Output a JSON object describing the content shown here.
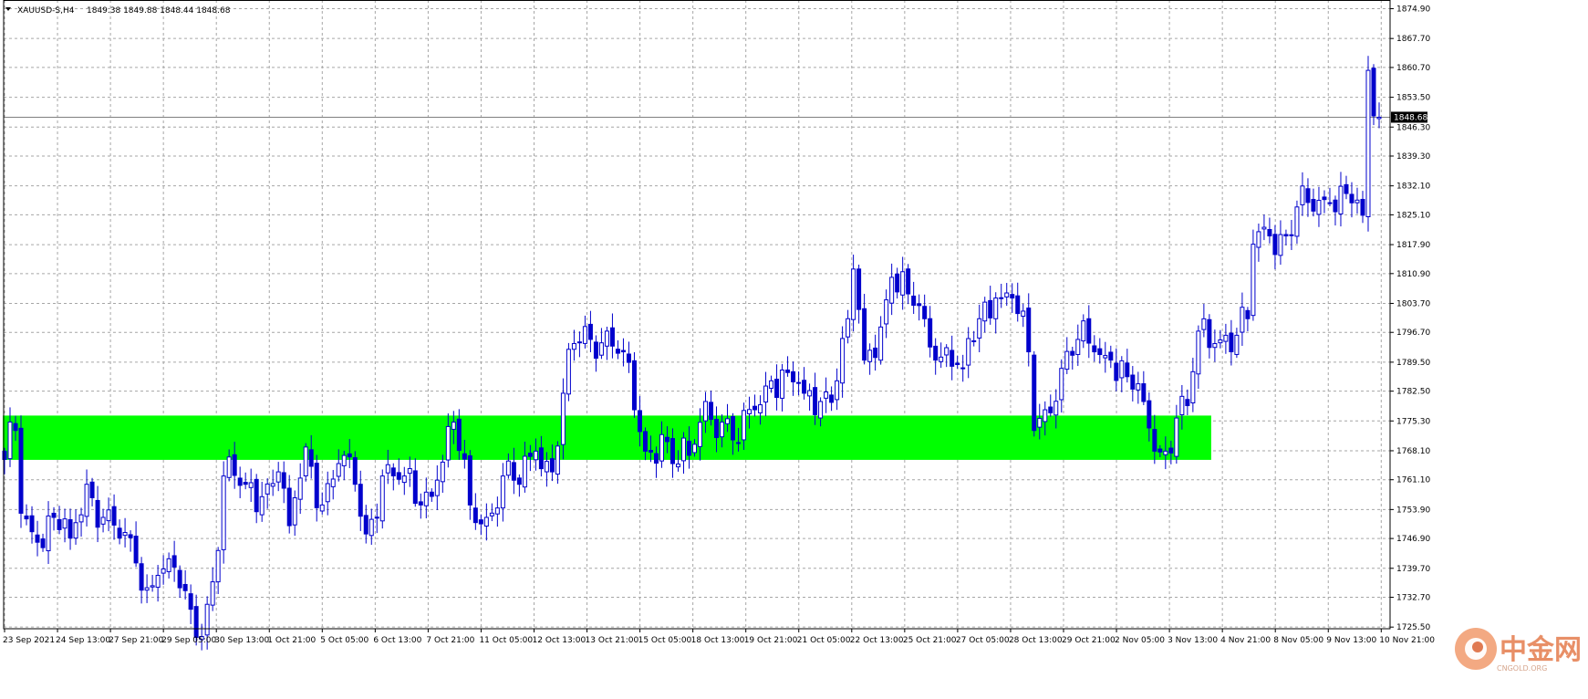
{
  "chart_header": {
    "symbol": "XAUUSD-S,H4",
    "ohlc": "1849.38 1849.88 1848.44 1848.68"
  },
  "current_price_label": "1848.68",
  "watermark": {
    "text_cn": "中金网",
    "text_en": "CNGOLD.ORG"
  },
  "colors": {
    "background": "#ffffff",
    "candle": "#0000cc",
    "grid": "#a6a6a6",
    "zone": "#00ff00",
    "price_line": "#7f7f7f"
  },
  "chart_data": {
    "type": "candlestick",
    "title": "",
    "xlabel": "",
    "ylabel": "",
    "ylim": [
      1725.1,
      1877.0
    ],
    "grid": true,
    "legend": "none",
    "y_ticks": [
      "1874.90",
      "1867.70",
      "1860.70",
      "1853.50",
      "1846.30",
      "1839.30",
      "1832.10",
      "1825.10",
      "1817.90",
      "1810.90",
      "1803.70",
      "1796.70",
      "1789.50",
      "1782.50",
      "1775.30",
      "1768.10",
      "1761.10",
      "1753.90",
      "1746.90",
      "1739.70",
      "1732.70",
      "1725.50"
    ],
    "x_ticks": [
      "23 Sep 2021",
      "24 Sep 13:00",
      "27 Sep 21:00",
      "29 Sep 05:00",
      "30 Sep 13:00",
      "1 Oct 21:00",
      "5 Oct 05:00",
      "6 Oct 13:00",
      "7 Oct 21:00",
      "11 Oct 05:00",
      "12 Oct 13:00",
      "13 Oct 21:00",
      "15 Oct 05:00",
      "18 Oct 13:00",
      "19 Oct 21:00",
      "21 Oct 05:00",
      "22 Oct 13:00",
      "25 Oct 21:00",
      "27 Oct 05:00",
      "28 Oct 13:00",
      "29 Oct 21:00",
      "2 Nov 05:00",
      "3 Nov 13:00",
      "4 Nov 21:00",
      "8 Nov 05:00",
      "9 Nov 13:00",
      "10 Nov 21:00"
    ],
    "candle_count": 252,
    "support_zone": {
      "upper": 1776.6,
      "lower": 1765.9,
      "start_candle": 0,
      "end_candle": 220
    },
    "current_price": 1848.68,
    "close_anchors": [
      [
        0,
        1766
      ],
      [
        2,
        1773
      ],
      [
        3,
        1753
      ],
      [
        6,
        1746
      ],
      [
        9,
        1752
      ],
      [
        12,
        1747
      ],
      [
        15,
        1760
      ],
      [
        18,
        1752
      ],
      [
        21,
        1747
      ],
      [
        24,
        1741
      ],
      [
        26,
        1735
      ],
      [
        28,
        1738
      ],
      [
        30,
        1742
      ],
      [
        32,
        1735
      ],
      [
        35,
        1723
      ],
      [
        37,
        1731
      ],
      [
        39,
        1744
      ],
      [
        40,
        1762
      ],
      [
        44,
        1760
      ],
      [
        47,
        1757
      ],
      [
        50,
        1763
      ],
      [
        52,
        1750
      ],
      [
        55,
        1769
      ],
      [
        58,
        1755
      ],
      [
        61,
        1765
      ],
      [
        64,
        1760
      ],
      [
        66,
        1748
      ],
      [
        69,
        1762
      ],
      [
        73,
        1762
      ],
      [
        76,
        1755
      ],
      [
        79,
        1761
      ],
      [
        82,
        1775
      ],
      [
        85,
        1755
      ],
      [
        88,
        1752
      ],
      [
        91,
        1762
      ],
      [
        94,
        1760
      ],
      [
        97,
        1768
      ],
      [
        100,
        1763
      ],
      [
        102,
        1782
      ],
      [
        104,
        1794
      ],
      [
        107,
        1795
      ],
      [
        110,
        1797
      ],
      [
        113,
        1792
      ],
      [
        115,
        1778
      ],
      [
        117,
        1768
      ],
      [
        120,
        1772
      ],
      [
        122,
        1765
      ],
      [
        125,
        1767
      ],
      [
        128,
        1780
      ],
      [
        131,
        1775
      ],
      [
        134,
        1770
      ],
      [
        137,
        1778
      ],
      [
        140,
        1785
      ],
      [
        143,
        1787
      ],
      [
        146,
        1782
      ],
      [
        149,
        1780
      ],
      [
        152,
        1785
      ],
      [
        154,
        1800
      ],
      [
        155,
        1812
      ],
      [
        157,
        1790
      ],
      [
        160,
        1798
      ],
      [
        162,
        1810
      ],
      [
        165,
        1806
      ],
      [
        168,
        1800
      ],
      [
        170,
        1790
      ],
      [
        172,
        1793
      ],
      [
        175,
        1788
      ],
      [
        178,
        1800
      ],
      [
        181,
        1805
      ],
      [
        184,
        1805
      ],
      [
        187,
        1792
      ],
      [
        188,
        1773
      ],
      [
        190,
        1778
      ],
      [
        193,
        1788
      ],
      [
        196,
        1795
      ],
      [
        199,
        1792
      ],
      [
        202,
        1790
      ],
      [
        205,
        1786
      ],
      [
        208,
        1780
      ],
      [
        210,
        1768
      ],
      [
        212,
        1768
      ],
      [
        214,
        1776
      ],
      [
        216,
        1779
      ],
      [
        218,
        1797
      ],
      [
        221,
        1794
      ],
      [
        223,
        1796
      ],
      [
        225,
        1796
      ],
      [
        227,
        1800
      ],
      [
        228,
        1818
      ],
      [
        231,
        1820
      ],
      [
        234,
        1820
      ],
      [
        236,
        1827
      ],
      [
        239,
        1826
      ],
      [
        242,
        1828
      ],
      [
        244,
        1832
      ],
      [
        246,
        1828
      ],
      [
        248,
        1825
      ],
      [
        249,
        1860
      ],
      [
        250,
        1849
      ],
      [
        251,
        1848.68
      ]
    ]
  }
}
